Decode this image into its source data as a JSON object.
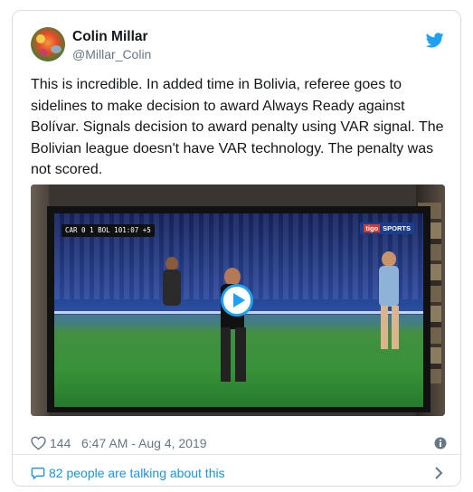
{
  "author": {
    "name": "Colin Millar",
    "handle": "@Millar_Colin",
    "avatar_icon": "avatar-image"
  },
  "tweet": {
    "text": "This is incredible. In added time in Bolivia, referee goes to sidelines to make decision to award Always Ready against Bolívar. Signals decision to award penalty using VAR signal. The Bolivian league doesn't have VAR technology. The penalty was not scored."
  },
  "media": {
    "scoreboard": "CAR 0 1 BOL 101:07 +5",
    "network_badge": "tigo",
    "network_label": "SPORTS",
    "play_icon": "play-icon"
  },
  "footer": {
    "like_count": "144",
    "timestamp": "6:47 AM - Aug 4, 2019"
  },
  "conversation": {
    "label": "82 people are talking about this"
  },
  "colors": {
    "accent": "#1da1f2",
    "link": "#1b95e0",
    "muted": "#657786",
    "text": "#14171a",
    "border": "#e1e8ed"
  },
  "icons": [
    "twitter-bird-icon",
    "heart-icon",
    "info-icon",
    "comment-icon",
    "chevron-right-icon",
    "play-icon"
  ]
}
